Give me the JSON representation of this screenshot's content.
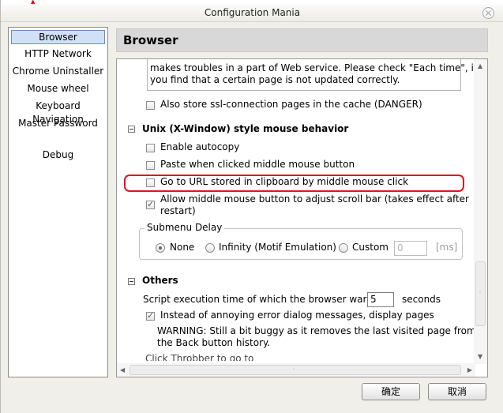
{
  "window": {
    "title": "Configuration Mania"
  },
  "sidebar": {
    "items": [
      {
        "label": "Browser",
        "selected": true
      },
      {
        "label": "HTTP Network"
      },
      {
        "label": "Chrome Uninstaller"
      },
      {
        "label": "Mouse wheel"
      },
      {
        "label": "Keyboard Navigation"
      },
      {
        "label": "Master Password"
      },
      {
        "label": "Debug"
      }
    ]
  },
  "panel": {
    "title": "Browser"
  },
  "content": {
    "cache_note_line1": "makes troubles in a part of Web service. Please check \"Each time\", if",
    "cache_note_line2": "you find that a certain page is not updated correctly.",
    "ssl_cache": {
      "label": "Also store ssl-connection pages in the cache (DANGER)",
      "checked": false
    },
    "unix_section": {
      "title": "Unix (X-Window) style mouse behavior",
      "autocopy": {
        "label": "Enable autocopy",
        "checked": false
      },
      "paste_middle": {
        "label": "Paste when clicked middle mouse button",
        "checked": false
      },
      "goto_url": {
        "label": "Go to URL stored in clipboard by middle mouse click",
        "checked": false
      },
      "middle_scroll": {
        "label_line1": "Allow middle mouse button to adjust scroll bar (takes effect after",
        "label_line2": "restart)",
        "checked": true
      }
    },
    "submenu_delay": {
      "legend": "Submenu Delay",
      "options": [
        {
          "label": "None",
          "selected": true
        },
        {
          "label": "Infinity (Motif Emulation)",
          "selected": false
        },
        {
          "label": "Custom",
          "selected": false
        }
      ],
      "custom_value": "0",
      "unit": "[ms]"
    },
    "others_section": {
      "title": "Others",
      "script_time_prefix": "Script execution time of which the browser warns",
      "script_time_value": "5",
      "script_time_suffix": "seconds",
      "error_dialog": {
        "label": "Instead of annoying error dialog messages, display pages",
        "checked": true
      },
      "warning_line1": "WARNING: Still a bit buggy as it removes the last visited page from",
      "warning_line2": "the Back button history.",
      "cut_off_label": "Click Throbber to go to"
    }
  },
  "buttons": {
    "ok": "确定",
    "cancel": "取消"
  },
  "colors": {
    "highlight": "#e0141c",
    "selection": "#cfe0f8"
  }
}
